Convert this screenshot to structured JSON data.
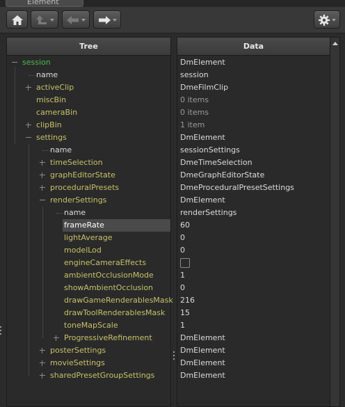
{
  "window": {
    "title": "Element Viewer"
  },
  "toolbar": {
    "home_icon": "home-icon",
    "up_icon": "arrow-up-icon",
    "back_icon": "arrow-left-icon",
    "forward_icon": "arrow-right-icon",
    "settings_icon": "gear-icon"
  },
  "columns": {
    "tree": "Tree",
    "data": "Data"
  },
  "tree": [
    {
      "label": "session",
      "value": "DmElement"
    },
    {
      "label": "name",
      "value": "session"
    },
    {
      "label": "activeClip",
      "value": "DmeFilmClip"
    },
    {
      "label": "miscBin",
      "value": "0 items"
    },
    {
      "label": "cameraBin",
      "value": "0 items"
    },
    {
      "label": "clipBin",
      "value": "1 item"
    },
    {
      "label": "settings",
      "value": "DmElement"
    },
    {
      "label": "name",
      "value": "sessionSettings"
    },
    {
      "label": "timeSelection",
      "value": "DmeTimeSelection"
    },
    {
      "label": "graphEditorState",
      "value": "DmeGraphEditorState"
    },
    {
      "label": "proceduralPresets",
      "value": "DmeProceduralPresetSettings"
    },
    {
      "label": "renderSettings",
      "value": "DmElement"
    },
    {
      "label": "name",
      "value": "renderSettings"
    },
    {
      "label": "frameRate",
      "value": "60"
    },
    {
      "label": "lightAverage",
      "value": "0"
    },
    {
      "label": "modelLod",
      "value": "0"
    },
    {
      "label": "engineCameraEffects",
      "value": ""
    },
    {
      "label": "ambientOcclusionMode",
      "value": "1"
    },
    {
      "label": "showAmbientOcclusion",
      "value": "0"
    },
    {
      "label": "drawGameRenderablesMask",
      "value": "216"
    },
    {
      "label": "drawToolRenderablesMask",
      "value": "15"
    },
    {
      "label": "toneMapScale",
      "value": "1"
    },
    {
      "label": "ProgressiveRefinement",
      "value": "DmElement"
    },
    {
      "label": "posterSettings",
      "value": "DmElement"
    },
    {
      "label": "movieSettings",
      "value": "DmElement"
    },
    {
      "label": "sharedPresetGroupSettings",
      "value": "DmElement"
    }
  ]
}
